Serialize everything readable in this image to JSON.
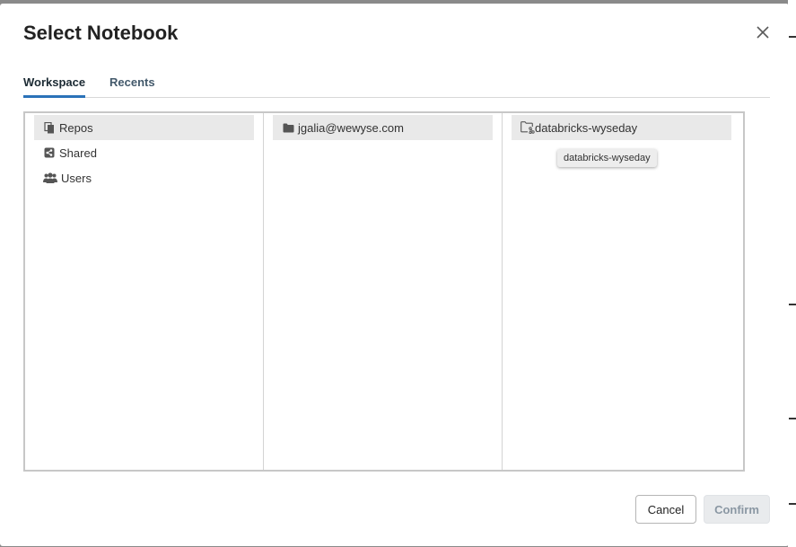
{
  "dialog": {
    "title": "Select Notebook",
    "tabs": [
      {
        "label": "Workspace",
        "active": true
      },
      {
        "label": "Recents",
        "active": false
      }
    ],
    "columns": [
      {
        "items": [
          {
            "label": "Repos",
            "icon": "repos-icon",
            "selected": true
          },
          {
            "label": "Shared",
            "icon": "shared-icon",
            "selected": false
          },
          {
            "label": "Users",
            "icon": "users-icon",
            "selected": false
          }
        ]
      },
      {
        "items": [
          {
            "label": "jgalia@wewyse.com",
            "icon": "folder-icon",
            "selected": true
          }
        ]
      },
      {
        "items": [
          {
            "label": "databricks-wyseday",
            "icon": "repo-folder-icon",
            "selected": true
          }
        ]
      }
    ],
    "tooltip": "databricks-wyseday",
    "buttons": {
      "cancel": "Cancel",
      "confirm": "Confirm"
    },
    "colors": {
      "active_tab_underline": "#2b72b8",
      "selected_row": "#e9e9e9"
    }
  }
}
